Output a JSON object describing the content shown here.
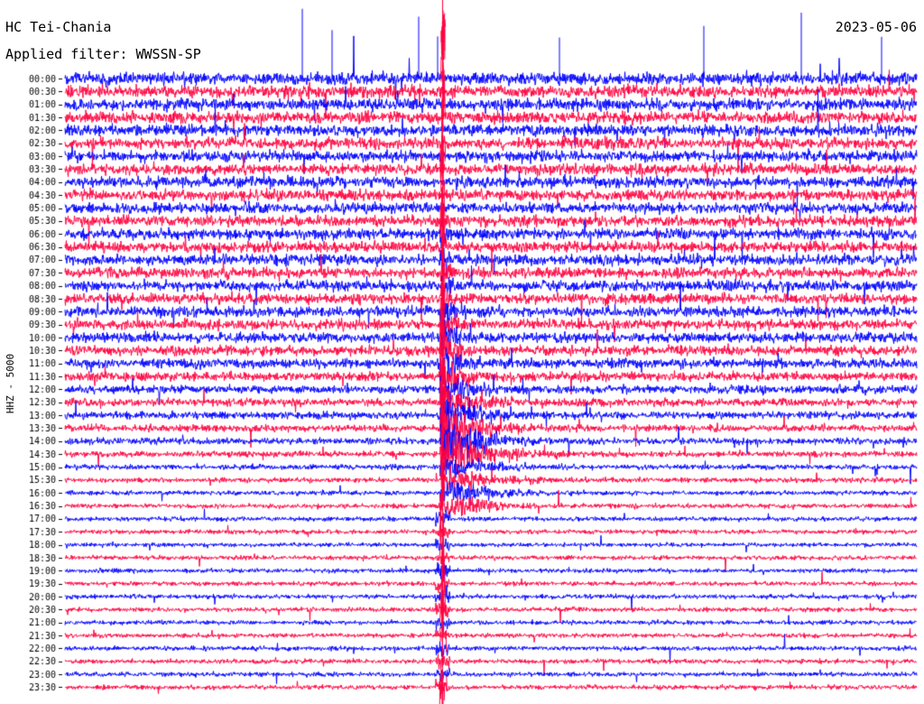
{
  "header": {
    "station": "HC Tei-Chania",
    "filter": "Applied filter: WWSSN-SP",
    "date": "2023-05-06"
  },
  "side_label": "HHZ - 5000",
  "colors": {
    "trace_a": "#0000ff",
    "trace_b": "#ff0040",
    "background": "#ffffff",
    "text": "#000000"
  },
  "chart_data": {
    "type": "line",
    "title": "HC Tei-Chania",
    "subtitle": "Applied filter: WWSSN-SP",
    "ylabel": "HHZ - 5000",
    "xlabel": "",
    "rows": [
      "00:00",
      "00:30",
      "01:00",
      "01:30",
      "02:00",
      "02:30",
      "03:00",
      "03:30",
      "04:00",
      "04:30",
      "05:00",
      "05:30",
      "06:00",
      "06:30",
      "07:00",
      "07:30",
      "08:00",
      "08:30",
      "09:00",
      "09:30",
      "10:00",
      "10:30",
      "11:00",
      "11:30",
      "12:00",
      "12:30",
      "13:00",
      "13:30",
      "14:00",
      "14:30",
      "15:00",
      "15:30",
      "16:00",
      "16:30",
      "17:00",
      "17:30",
      "18:00",
      "18:30",
      "19:00",
      "19:30",
      "20:00",
      "20:30",
      "21:00",
      "21:30",
      "22:00",
      "22:30",
      "23:00",
      "23:30"
    ],
    "row_colors": [
      "#0000ff",
      "#ff0040"
    ],
    "noise_amplitude_relative": [
      1.0,
      0.98,
      0.96,
      0.95,
      0.93,
      0.92,
      0.9,
      0.9,
      0.9,
      0.89,
      0.88,
      0.88,
      0.88,
      0.87,
      0.86,
      0.86,
      0.85,
      0.85,
      0.84,
      0.84,
      0.82,
      0.8,
      0.78,
      0.74,
      0.68,
      0.64,
      0.6,
      0.56,
      0.52,
      0.48,
      0.42,
      0.4,
      0.38,
      0.37,
      0.36,
      0.36,
      0.35,
      0.35,
      0.35,
      0.35,
      0.35,
      0.36,
      0.36,
      0.36,
      0.37,
      0.37,
      0.37,
      0.38
    ],
    "event": {
      "start_row": "05:30",
      "peak_row": "14:30",
      "minute_in_window": 13.3,
      "description_color": "#ff0040"
    },
    "grid": false,
    "legend": "none"
  }
}
